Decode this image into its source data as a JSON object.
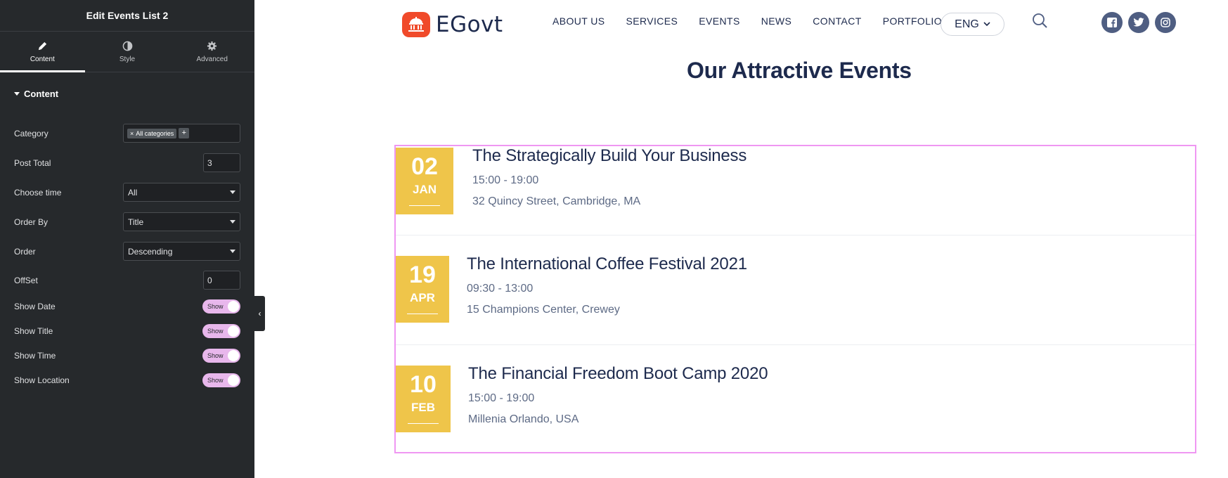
{
  "panel": {
    "title": "Edit Events List 2",
    "tabs": [
      {
        "label": "Content",
        "icon": "pencil-icon"
      },
      {
        "label": "Style",
        "icon": "half-circle-icon"
      },
      {
        "label": "Advanced",
        "icon": "gear-icon"
      }
    ],
    "active_tab": "Content",
    "section_label": "Content",
    "controls": {
      "category": {
        "label": "Category",
        "chip": "All categories",
        "chip_remove": "×",
        "add": "+"
      },
      "post_total": {
        "label": "Post Total",
        "value": "3"
      },
      "choose_time": {
        "label": "Choose time",
        "value": "All"
      },
      "order_by": {
        "label": "Order By",
        "value": "Title"
      },
      "order": {
        "label": "Order",
        "value": "Descending"
      },
      "offset": {
        "label": "OffSet",
        "value": "0"
      },
      "show_date": {
        "label": "Show Date",
        "switch": "Show"
      },
      "show_title": {
        "label": "Show Title",
        "switch": "Show"
      },
      "show_time": {
        "label": "Show Time",
        "switch": "Show"
      },
      "show_location": {
        "label": "Show Location",
        "switch": "Show"
      }
    },
    "collapse_icon": "‹"
  },
  "site": {
    "logo_text": "EGovt",
    "nav": [
      "ABOUT US",
      "SERVICES",
      "EVENTS",
      "NEWS",
      "CONTACT",
      "PORTFOLIO"
    ],
    "language": "ENG",
    "socials": [
      "facebook-icon",
      "twitter-icon",
      "instagram-icon"
    ],
    "section_title": "Our Attractive Events",
    "colors": {
      "accent": "#efc54a",
      "navy": "#1d2a4d",
      "logo": "#f04a2a",
      "selection": "#ef97f2"
    },
    "events": [
      {
        "day": "02",
        "month": "JAN",
        "title": "The Strategically Build Your Business",
        "time": "15:00 - 19:00",
        "location": "32 Quincy Street, Cambridge, MA"
      },
      {
        "day": "19",
        "month": "APR",
        "title": "The International Coffee Festival 2021",
        "time": "09:30 - 13:00",
        "location": "15 Champions Center, Crewey"
      },
      {
        "day": "10",
        "month": "FEB",
        "title": "The Financial Freedom Boot Camp 2020",
        "time": "15:00 - 19:00",
        "location": "Millenia Orlando, USA"
      }
    ]
  }
}
